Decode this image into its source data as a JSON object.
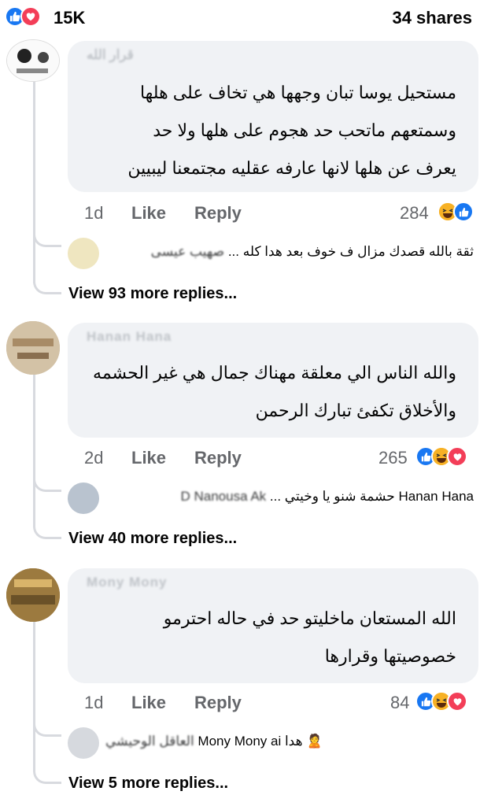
{
  "header": {
    "reaction_count": "15K",
    "shares": "34 shares",
    "icons": [
      "like-icon",
      "love-icon"
    ]
  },
  "comments": [
    {
      "author": "قرار الله",
      "lines": [
        "مستحيل يوسا تبان وجهها هي تخاف على هلها",
        "وسمتعهم ماتحب حد هجوم على هلها  ولا حد",
        "يعرف عن هلها لانها عارفه عقليه مجتمعنا ليبيين"
      ],
      "time": "1d",
      "like": "Like",
      "reply": "Reply",
      "reactions": "284",
      "reaction_icons": [
        "haha-icon",
        "like-icon"
      ],
      "reply_preview": {
        "name": "صهيب عيسى",
        "text": "ثقة بالله قصدك مزال ف خوف بعد هدا كله ..."
      },
      "view_more": "View 93 more replies..."
    },
    {
      "author": "Hanan Hana",
      "lines": [
        "والله الناس الي معلقة مهناك جمال هي غير الحشمه",
        "والأخلاق تكفئ تبارك الرحمن"
      ],
      "time": "2d",
      "like": "Like",
      "reply": "Reply",
      "reactions": "265",
      "reaction_icons": [
        "like-icon",
        "haha-icon",
        "love-icon"
      ],
      "reply_preview": {
        "name": "D Nanousa Ak",
        "text": "Hanan Hana حشمة شنو يا وخيتي ..."
      },
      "view_more": "View 40 more replies..."
    },
    {
      "author": "Mony Mony",
      "lines": [
        "الله المستعان ماخليتو حد في حاله احترمو",
        "خصوصيتها وقرارها"
      ],
      "time": "1d",
      "like": "Like",
      "reply": "Reply",
      "reactions": "84",
      "reaction_icons": [
        "like-icon",
        "haha-icon",
        "love-icon"
      ],
      "reply_preview": {
        "name": "العاقل الوحيشي",
        "text": "Mony Mony ai هدا"
      },
      "view_more": "View 5 more replies..."
    }
  ]
}
